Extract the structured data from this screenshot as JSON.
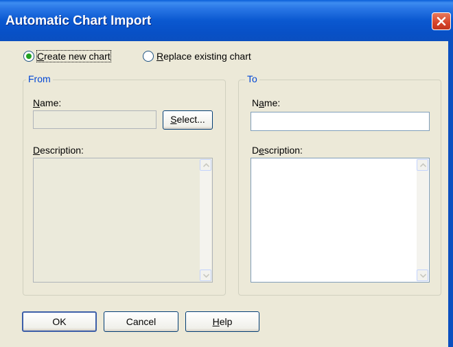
{
  "window": {
    "title": "Automatic Chart Import",
    "close_icon": "close-icon"
  },
  "mode": {
    "options": [
      {
        "label": "Create new chart",
        "selected": true
      },
      {
        "label": "Replace existing chart",
        "selected": false
      }
    ]
  },
  "from": {
    "legend": "From",
    "name_label": "Name:",
    "name_value": "",
    "select_label": "Select...",
    "description_label": "Description:",
    "description_value": ""
  },
  "to": {
    "legend": "To",
    "name_label": "Name:",
    "name_value": "",
    "description_label": "Description:",
    "description_value": ""
  },
  "buttons": {
    "ok": "OK",
    "cancel": "Cancel",
    "help": "Help"
  },
  "colors": {
    "titlebar": "#0a58d0",
    "dialog_bg": "#ece9d8",
    "group_legend": "#0046d5",
    "radio_dot": "#21a121",
    "close_button": "#d6432a"
  }
}
